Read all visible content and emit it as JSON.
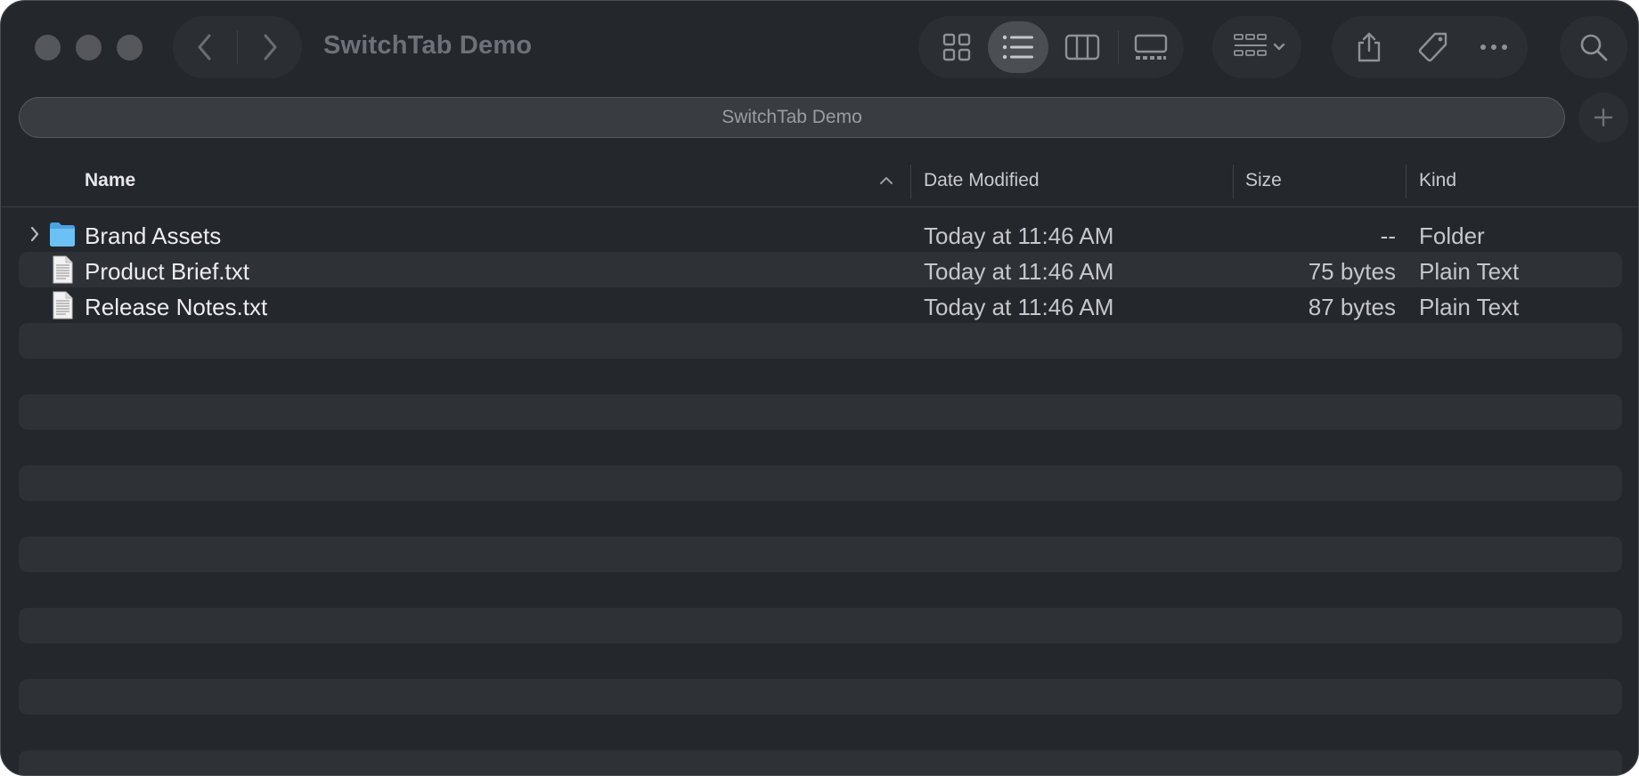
{
  "window": {
    "title": "SwitchTab Demo",
    "tab_label": "SwitchTab Demo"
  },
  "toolbar": {
    "back_icon": "chevron-left-icon",
    "forward_icon": "chevron-right-icon",
    "views": [
      "icon-view",
      "list-view",
      "column-view",
      "gallery-view"
    ],
    "active_view": "list-view",
    "group_icon": "group-grid-icon",
    "share_icon": "share-icon",
    "tag_icon": "tag-icon",
    "more_icon": "ellipsis-icon",
    "search_icon": "search-icon",
    "add_tab_icon": "plus-icon"
  },
  "columns": {
    "name": "Name",
    "date": "Date Modified",
    "size": "Size",
    "kind": "Kind",
    "sort_indicator": "chevron-up-icon"
  },
  "files": [
    {
      "name": "Brand Assets",
      "date": "Today at 11:46 AM",
      "size": "--",
      "kind": "Folder",
      "type": "folder"
    },
    {
      "name": "Product Brief.txt",
      "date": "Today at 11:46 AM",
      "size": "75 bytes",
      "kind": "Plain Text",
      "type": "text"
    },
    {
      "name": "Release Notes.txt",
      "date": "Today at 11:46 AM",
      "size": "87 bytes",
      "kind": "Plain Text",
      "type": "text"
    }
  ],
  "colors": {
    "window_bg": "#24272c",
    "stripe": "#2e3136",
    "folder_blue": "#5bb6f0",
    "text_primary": "#ececee"
  }
}
